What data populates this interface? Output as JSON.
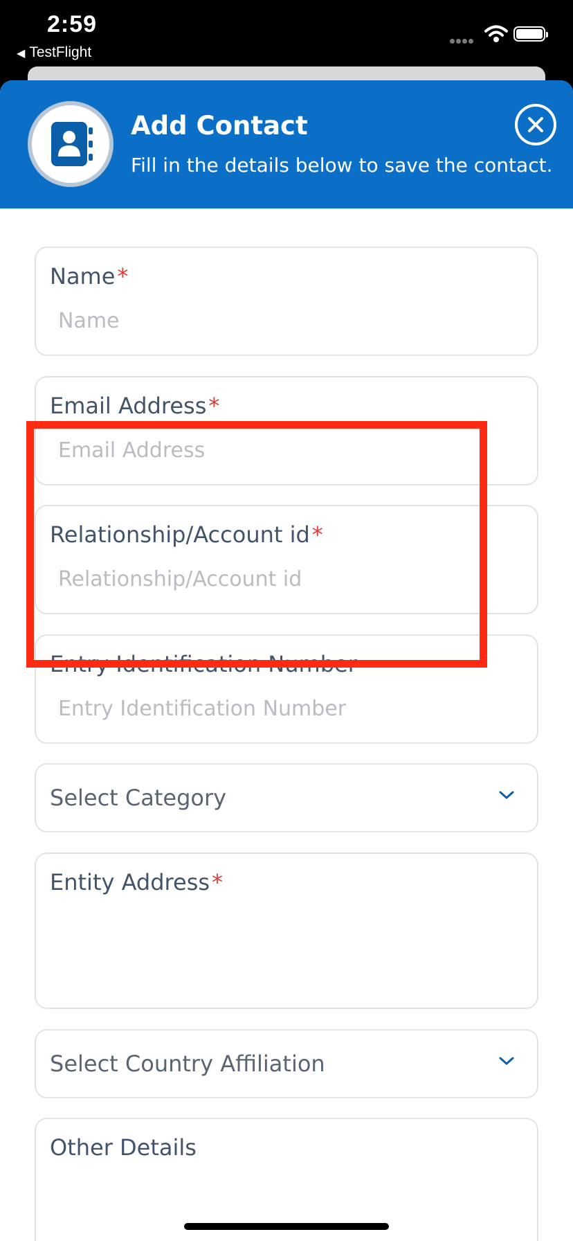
{
  "status_bar": {
    "time": "2:59",
    "back_app": "TestFlight"
  },
  "header": {
    "title": "Add Contact",
    "subtitle": "Fill in the details below to save the contact.",
    "accent_color": "#0b6ec7"
  },
  "form": {
    "name": {
      "label": "Name",
      "required_mark": "*",
      "placeholder": "Name"
    },
    "email": {
      "label": "Email Address",
      "required_mark": "*",
      "placeholder": "Email Address"
    },
    "relationship": {
      "label": "Relationship/Account id",
      "required_mark": "*",
      "placeholder": "Relationship/Account id"
    },
    "entry_id": {
      "label": "Entry Identification Number",
      "placeholder": "Entry Identification Number"
    },
    "category": {
      "label": "Select Category"
    },
    "entity_address": {
      "label": "Entity Address",
      "required_mark": "*"
    },
    "country": {
      "label": "Select Country Affiliation"
    },
    "other_details": {
      "label": "Other Details"
    }
  },
  "highlight_color": "#ff2a12"
}
